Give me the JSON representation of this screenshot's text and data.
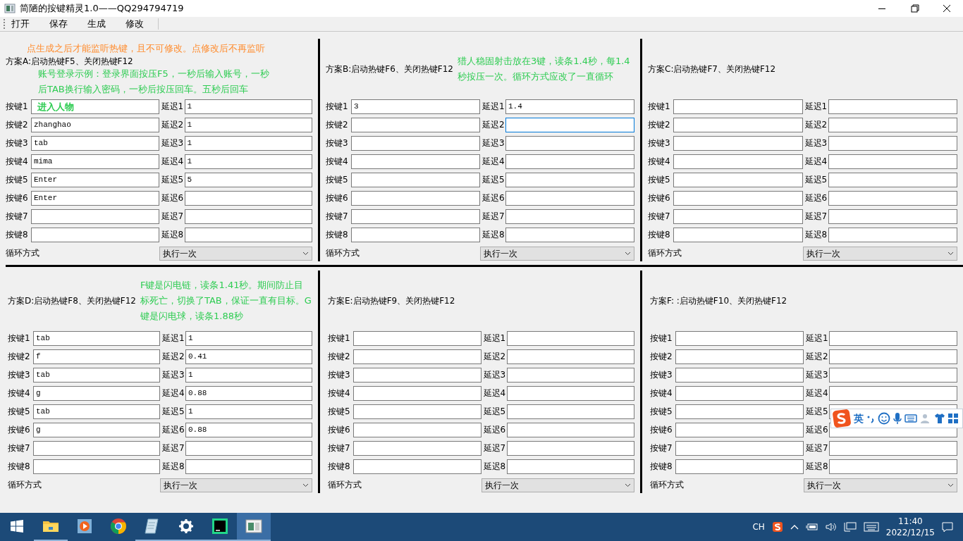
{
  "window": {
    "title": "简陋的按键精灵1.0——QQ294794719"
  },
  "toolbar": [
    "打开",
    "保存",
    "生成",
    "修改"
  ],
  "panels": [
    {
      "title": "方案A:启动热键F5、关闭热键F12",
      "notes": [
        {
          "kind": "above",
          "text": "点生成之后才能监听热键，且不可修改。点修改后不再监听",
          "color": "#ff8c2e"
        },
        {
          "kind": "below",
          "text": "账号登录示例：登录界面按压F5，一秒后输入账号，一秒后TAB换行输入密码，一秒后按压回车。五秒后回车",
          "color": "#2ecc52"
        },
        {
          "kind": "field",
          "text": "进入人物",
          "color": "#2ecc52"
        }
      ],
      "rows": [
        {
          "key_label": "按键1",
          "delay_label": "延迟1",
          "delay": "1",
          "focused": false
        },
        {
          "key_label": "按键2",
          "key": "zhanghao",
          "delay_label": "延迟2",
          "delay": "1",
          "focused": false
        },
        {
          "key_label": "按键3",
          "key": "tab",
          "delay_label": "延迟3",
          "delay": "1",
          "focused": false
        },
        {
          "key_label": "按键4",
          "key": "mima",
          "delay_label": "延迟4",
          "delay": "1",
          "focused": false
        },
        {
          "key_label": "按键5",
          "key": "Enter",
          "delay_label": "延迟5",
          "delay": "5",
          "focused": false
        },
        {
          "key_label": "按键6",
          "key": "Enter",
          "delay_label": "延迟6",
          "focused": false
        },
        {
          "key_label": "按键7",
          "delay_label": "延迟7",
          "focused": false
        },
        {
          "key_label": "按键8",
          "delay_label": "延迟8",
          "focused": false
        }
      ],
      "loop_label": "循环方式",
      "loop_value": "执行一次"
    },
    {
      "title": "方案B:启动热键F6、关闭热键F12",
      "notes": [
        {
          "kind": "beside",
          "text": "猎人稳固射击放在3键，读条1.4秒，每1.4秒按压一次。循环方式应改了一直循环",
          "color": "#2ecc52"
        }
      ],
      "rows": [
        {
          "key_label": "按键1",
          "key": "3",
          "delay_label": "延迟1",
          "delay": "1.4",
          "focused": false
        },
        {
          "key_label": "按键2",
          "delay_label": "延迟2",
          "focused": true
        },
        {
          "key_label": "按键3",
          "delay_label": "延迟3",
          "focused": false
        },
        {
          "key_label": "按键4",
          "delay_label": "延迟4",
          "focused": false
        },
        {
          "key_label": "按键5",
          "delay_label": "延迟5",
          "focused": false
        },
        {
          "key_label": "按键6",
          "delay_label": "延迟6",
          "focused": false
        },
        {
          "key_label": "按键7",
          "delay_label": "延迟7",
          "focused": false
        },
        {
          "key_label": "按键8",
          "delay_label": "延迟8",
          "focused": false
        }
      ],
      "loop_label": "循环方式",
      "loop_value": "执行一次"
    },
    {
      "title": "方案C:启动热键F7、关闭热键F12",
      "rows": [
        {
          "key_label": "按键1",
          "delay_label": "延迟1",
          "focused": false
        },
        {
          "key_label": "按键2",
          "delay_label": "延迟2",
          "focused": false
        },
        {
          "key_label": "按键3",
          "delay_label": "延迟3",
          "focused": false
        },
        {
          "key_label": "按键4",
          "delay_label": "延迟4",
          "focused": false
        },
        {
          "key_label": "按键5",
          "delay_label": "延迟5",
          "focused": false
        },
        {
          "key_label": "按键6",
          "delay_label": "延迟6",
          "focused": false
        },
        {
          "key_label": "按键7",
          "delay_label": "延迟7",
          "focused": false
        },
        {
          "key_label": "按键8",
          "delay_label": "延迟8",
          "focused": false
        }
      ],
      "loop_label": "循环方式",
      "loop_value": "执行一次"
    },
    {
      "title": "方案D:启动热键F8、关闭热键F12",
      "notes": [
        {
          "kind": "beside",
          "text": "F键是闪电链，读条1.41秒。期间防止目标死亡，切换了TAB，保证一直有目标。G键是闪电球，读条1.88秒",
          "color": "#2ecc52"
        }
      ],
      "rows": [
        {
          "key_label": "按键1",
          "key": "tab",
          "delay_label": "延迟1",
          "delay": "1",
          "focused": false
        },
        {
          "key_label": "按键2",
          "key": "f",
          "delay_label": "延迟2",
          "delay": "0.41",
          "focused": false
        },
        {
          "key_label": "按键3",
          "key": "tab",
          "delay_label": "延迟3",
          "delay": "1",
          "focused": false
        },
        {
          "key_label": "按键4",
          "key": "g",
          "delay_label": "延迟4",
          "delay": "0.88",
          "focused": false
        },
        {
          "key_label": "按键5",
          "key": "tab",
          "delay_label": "延迟5",
          "delay": "1",
          "focused": false
        },
        {
          "key_label": "按键6",
          "key": "g",
          "delay_label": "延迟6",
          "delay": "0.88",
          "focused": false
        },
        {
          "key_label": "按键7",
          "delay_label": "延迟7",
          "focused": false
        },
        {
          "key_label": "按键8",
          "delay_label": "延迟8",
          "focused": false
        }
      ],
      "loop_label": "循环方式",
      "loop_value": "执行一次"
    },
    {
      "title": "方案E:启动热键F9、关闭热键F12",
      "rows": [
        {
          "key_label": "按键1",
          "delay_label": "延迟1",
          "focused": false
        },
        {
          "key_label": "按键2",
          "delay_label": "延迟2",
          "focused": false
        },
        {
          "key_label": "按键3",
          "delay_label": "延迟3",
          "focused": false
        },
        {
          "key_label": "按键4",
          "delay_label": "延迟4",
          "focused": false
        },
        {
          "key_label": "按键5",
          "delay_label": "延迟5",
          "focused": false
        },
        {
          "key_label": "按键6",
          "delay_label": "延迟6",
          "focused": false
        },
        {
          "key_label": "按键7",
          "delay_label": "延迟7",
          "focused": false
        },
        {
          "key_label": "按键8",
          "delay_label": "延迟8",
          "focused": false
        }
      ],
      "loop_label": "循环方式",
      "loop_value": "执行一次"
    },
    {
      "title": "方案F: :启动热键F10、关闭热键F12",
      "rows": [
        {
          "key_label": "按键1",
          "delay_label": "延迟1",
          "focused": false
        },
        {
          "key_label": "按键2",
          "delay_label": "延迟2",
          "focused": false
        },
        {
          "key_label": "按键3",
          "delay_label": "延迟3",
          "focused": false
        },
        {
          "key_label": "按键4",
          "delay_label": "延迟4",
          "focused": false
        },
        {
          "key_label": "按键5",
          "delay_label": "延迟5",
          "focused": false
        },
        {
          "key_label": "按键6",
          "delay_label": "延迟6",
          "focused": false
        },
        {
          "key_label": "按键7",
          "delay_label": "延迟7",
          "focused": false
        },
        {
          "key_label": "按键8",
          "delay_label": "延迟8",
          "focused": false
        }
      ],
      "loop_label": "循环方式",
      "loop_value": "执行一次"
    }
  ],
  "ime_toolbar": {
    "mode": "英"
  },
  "taskbar": {
    "apps": [
      {
        "kind": "explorer",
        "running": true,
        "selected": false
      },
      {
        "kind": "media",
        "running": false,
        "selected": false
      },
      {
        "kind": "chrome",
        "running": false,
        "selected": false
      },
      {
        "kind": "notepad",
        "running": true,
        "selected": false
      },
      {
        "kind": "settings",
        "running": true,
        "selected": false
      },
      {
        "kind": "pycharm",
        "running": true,
        "selected": false
      },
      {
        "kind": "window",
        "running": true,
        "selected": true
      }
    ],
    "language": "CH",
    "time": "11:40",
    "date": "2022/12/15"
  }
}
